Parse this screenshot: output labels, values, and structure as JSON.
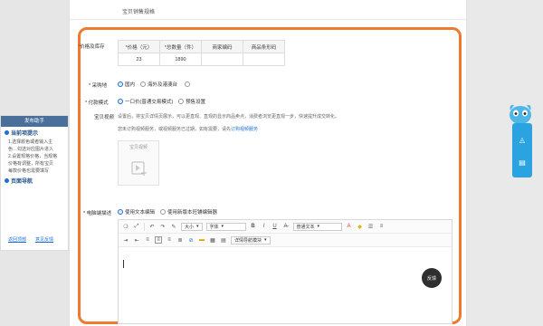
{
  "page": {
    "section_title": "宝贝销售规格"
  },
  "left_panel": {
    "header": "发布助手",
    "sec1": "当前项提示",
    "body": [
      "1.选择颜色或者输入主",
      "色…勾选对应图片进入",
      "2.设置规格价格，当规格",
      "价格有调整，所有宝贝",
      "每款价格也需要填写"
    ],
    "sec2": "页面导航",
    "link1": "返回顶部",
    "link2": "意见反馈"
  },
  "spec": {
    "label": "价格及库存",
    "headers": [
      "*价格（元）",
      "*总数量（件）",
      "商家编码",
      "商品条形码"
    ],
    "row": [
      "23",
      "1890",
      "",
      ""
    ]
  },
  "origin": {
    "label": "* 采购地",
    "options": [
      "国内",
      "海外及港澳台"
    ],
    "selected": 0
  },
  "payment": {
    "label": "* 付款模式",
    "options": [
      "一口价(普通交易模式)",
      "预售设置"
    ],
    "selected": 0
  },
  "main_image": {
    "label": "宝贝视频",
    "desc1": "设置后，将宝贝详情页展示，可以更直观、直观的显示商品卖点，消费者浏览更直观一步，快速提升成交转化。",
    "desc2": "您未订购视频服务，或视频服务已过期，如有需要，请先",
    "desc2_link": "订购视频服务",
    "upload_caption": "宝贝视频"
  },
  "detail": {
    "label": "* 电脑端描述",
    "options": [
      "使用文本编辑",
      "使用新版本旺铺编辑器"
    ],
    "selected": 0
  },
  "editor": {
    "font_size": "大小",
    "font_family": "字体",
    "text_style": "普通文本",
    "module": "详情导航模块",
    "float_button": "反馈"
  }
}
